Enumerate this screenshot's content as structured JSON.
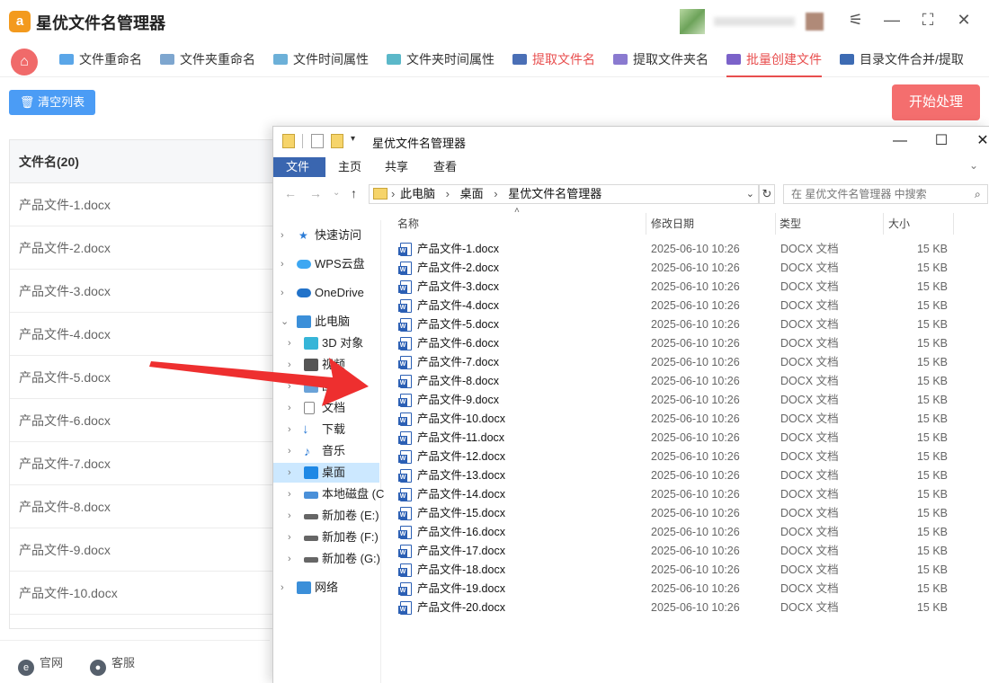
{
  "app": {
    "title": "星优文件名管理器",
    "logo_text": "a"
  },
  "nav": {
    "items": [
      {
        "label": "文件重命名",
        "icon": "rename-file-icon"
      },
      {
        "label": "文件夹重命名",
        "icon": "rename-folder-icon"
      },
      {
        "label": "文件时间属性",
        "icon": "file-time-icon"
      },
      {
        "label": "文件夹时间属性",
        "icon": "folder-time-icon"
      },
      {
        "label": "提取文件名",
        "icon": "extract-filename-icon"
      },
      {
        "label": "提取文件夹名",
        "icon": "extract-foldername-icon"
      },
      {
        "label": "批量创建文件",
        "icon": "batch-create-icon"
      },
      {
        "label": "目录文件合并/提取",
        "icon": "merge-icon"
      }
    ],
    "active_index": 6
  },
  "toolbar": {
    "clear_label": "清空列表",
    "start_label": "开始处理"
  },
  "list": {
    "header": "文件名(20)",
    "rows": [
      "产品文件-1.docx",
      "产品文件-2.docx",
      "产品文件-3.docx",
      "产品文件-4.docx",
      "产品文件-5.docx",
      "产品文件-6.docx",
      "产品文件-7.docx",
      "产品文件-8.docx",
      "产品文件-9.docx",
      "产品文件-10.docx"
    ]
  },
  "footer": {
    "website_label": "官网",
    "support_label": "客服"
  },
  "explorer": {
    "title": "星优文件名管理器",
    "ribbon_tabs": [
      "文件",
      "主页",
      "共享",
      "查看"
    ],
    "breadcrumb": [
      "此电脑",
      "桌面",
      "星优文件名管理器"
    ],
    "search_placeholder": "在 星优文件名管理器 中搜索",
    "columns": {
      "name": "名称",
      "date": "修改日期",
      "type": "类型",
      "size": "大小"
    },
    "tree": [
      {
        "label": "快速访问",
        "icon": "star-icon",
        "color": "#2b7bd6"
      },
      {
        "label": "WPS云盘",
        "icon": "cloud-icon",
        "color": "#3da7f2"
      },
      {
        "label": "OneDrive",
        "icon": "cloud-icon",
        "color": "#2272c9"
      },
      {
        "label": "此电脑",
        "icon": "computer-icon",
        "color": "#3b8fd9"
      },
      {
        "label": "3D 对象",
        "icon": "3d-objects-icon",
        "color": "#36b5d8"
      },
      {
        "label": "视频",
        "icon": "video-icon",
        "color": "#555555"
      },
      {
        "label": "图片",
        "icon": "pictures-icon",
        "color": "#6aa2d8"
      },
      {
        "label": "文档",
        "icon": "documents-icon",
        "color": "#8a8a8a"
      },
      {
        "label": "下载",
        "icon": "download-icon",
        "color": "#2b7bd6"
      },
      {
        "label": "音乐",
        "icon": "music-icon",
        "color": "#2b7bd6"
      },
      {
        "label": "桌面",
        "icon": "desktop-icon",
        "color": "#1e88e5"
      },
      {
        "label": "本地磁盘 (C",
        "icon": "drive-icon",
        "color": "#4a90d9"
      },
      {
        "label": "新加卷 (E:)",
        "icon": "drive-icon",
        "color": "#666666"
      },
      {
        "label": "新加卷 (F:)",
        "icon": "drive-icon",
        "color": "#666666"
      },
      {
        "label": "新加卷 (G:)",
        "icon": "drive-icon",
        "color": "#666666"
      },
      {
        "label": "网络",
        "icon": "network-icon",
        "color": "#3b8fd9"
      }
    ],
    "files": [
      {
        "name": "产品文件-1.docx",
        "date": "2025-06-10 10:26",
        "type": "DOCX 文档",
        "size": "15 KB"
      },
      {
        "name": "产品文件-2.docx",
        "date": "2025-06-10 10:26",
        "type": "DOCX 文档",
        "size": "15 KB"
      },
      {
        "name": "产品文件-3.docx",
        "date": "2025-06-10 10:26",
        "type": "DOCX 文档",
        "size": "15 KB"
      },
      {
        "name": "产品文件-4.docx",
        "date": "2025-06-10 10:26",
        "type": "DOCX 文档",
        "size": "15 KB"
      },
      {
        "name": "产品文件-5.docx",
        "date": "2025-06-10 10:26",
        "type": "DOCX 文档",
        "size": "15 KB"
      },
      {
        "name": "产品文件-6.docx",
        "date": "2025-06-10 10:26",
        "type": "DOCX 文档",
        "size": "15 KB"
      },
      {
        "name": "产品文件-7.docx",
        "date": "2025-06-10 10:26",
        "type": "DOCX 文档",
        "size": "15 KB"
      },
      {
        "name": "产品文件-8.docx",
        "date": "2025-06-10 10:26",
        "type": "DOCX 文档",
        "size": "15 KB"
      },
      {
        "name": "产品文件-9.docx",
        "date": "2025-06-10 10:26",
        "type": "DOCX 文档",
        "size": "15 KB"
      },
      {
        "name": "产品文件-10.docx",
        "date": "2025-06-10 10:26",
        "type": "DOCX 文档",
        "size": "15 KB"
      },
      {
        "name": "产品文件-11.docx",
        "date": "2025-06-10 10:26",
        "type": "DOCX 文档",
        "size": "15 KB"
      },
      {
        "name": "产品文件-12.docx",
        "date": "2025-06-10 10:26",
        "type": "DOCX 文档",
        "size": "15 KB"
      },
      {
        "name": "产品文件-13.docx",
        "date": "2025-06-10 10:26",
        "type": "DOCX 文档",
        "size": "15 KB"
      },
      {
        "name": "产品文件-14.docx",
        "date": "2025-06-10 10:26",
        "type": "DOCX 文档",
        "size": "15 KB"
      },
      {
        "name": "产品文件-15.docx",
        "date": "2025-06-10 10:26",
        "type": "DOCX 文档",
        "size": "15 KB"
      },
      {
        "name": "产品文件-16.docx",
        "date": "2025-06-10 10:26",
        "type": "DOCX 文档",
        "size": "15 KB"
      },
      {
        "name": "产品文件-17.docx",
        "date": "2025-06-10 10:26",
        "type": "DOCX 文档",
        "size": "15 KB"
      },
      {
        "name": "产品文件-18.docx",
        "date": "2025-06-10 10:26",
        "type": "DOCX 文档",
        "size": "15 KB"
      },
      {
        "name": "产品文件-19.docx",
        "date": "2025-06-10 10:26",
        "type": "DOCX 文档",
        "size": "15 KB"
      },
      {
        "name": "产品文件-20.docx",
        "date": "2025-06-10 10:26",
        "type": "DOCX 文档",
        "size": "15 KB"
      }
    ]
  },
  "colors": {
    "accent_red": "#e84e4e",
    "clear_button": "#4b9cf5",
    "start_button": "#f46e6e",
    "file_tab": "#3a66b0",
    "tree_selected": "#cce8ff",
    "arrow": "#ee2f2f"
  }
}
